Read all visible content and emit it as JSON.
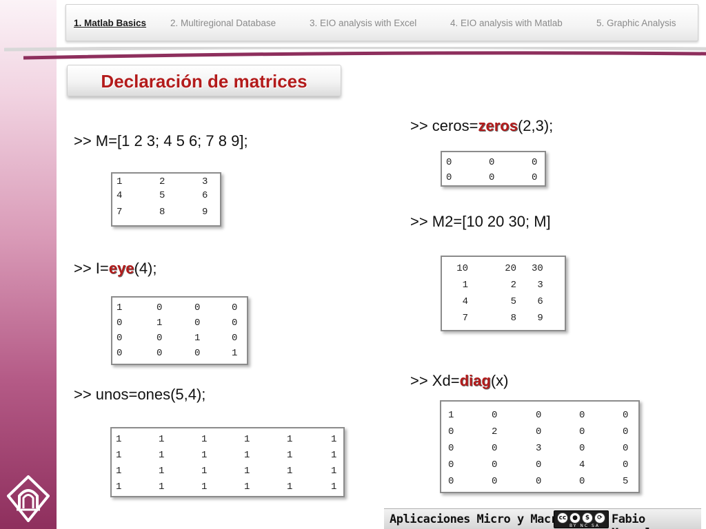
{
  "nav": {
    "items": [
      {
        "label": "1. Matlab Basics",
        "active": true
      },
      {
        "label": "2. Multiregional Database",
        "active": false
      },
      {
        "label": "3. EIO analysis with Excel",
        "active": false
      },
      {
        "label": "4. EIO analysis with Matlab",
        "active": false
      },
      {
        "label": "5. Graphic Analysis",
        "active": false
      }
    ]
  },
  "title": "Declaración de matrices",
  "commands": {
    "m": {
      "prefix": ">> M=[1 2 3; 4 5 6; 7 8 9];"
    },
    "eye": {
      "prefix": ">> I=",
      "keyword": "eye",
      "suffix": "(4);"
    },
    "ones": {
      "prefix": ">> unos=ones(5,4);"
    },
    "zeros": {
      "prefix": ">> ceros=",
      "keyword": "zeros",
      "suffix": "(2,3);"
    },
    "m2": {
      "prefix": ">> M2=[10 20 30; M]"
    },
    "diag": {
      "prefix": ">> Xd=",
      "keyword": "diag",
      "suffix": "(x)"
    }
  },
  "matrices": {
    "m": [
      [
        "1",
        "2",
        "3"
      ],
      [
        "4",
        "5",
        "6"
      ],
      [
        "7",
        "8",
        "9"
      ]
    ],
    "eye": [
      [
        "1",
        "0",
        "0",
        "0"
      ],
      [
        "0",
        "1",
        "0",
        "0"
      ],
      [
        "0",
        "0",
        "1",
        "0"
      ],
      [
        "0",
        "0",
        "0",
        "1"
      ]
    ],
    "ones": [
      [
        "1",
        "1",
        "1",
        "1",
        "1",
        "1"
      ],
      [
        "1",
        "1",
        "1",
        "1",
        "1",
        "1"
      ],
      [
        "1",
        "1",
        "1",
        "1",
        "1",
        "1"
      ],
      [
        "1",
        "1",
        "1",
        "1",
        "1",
        "1"
      ]
    ],
    "zeros": [
      [
        "0",
        "0",
        "0"
      ],
      [
        "0",
        "0",
        "0"
      ]
    ],
    "m2": [
      [
        "10",
        "20",
        "30"
      ],
      [
        "1",
        "2",
        "3"
      ],
      [
        "4",
        "5",
        "6"
      ],
      [
        "7",
        "8",
        "9"
      ]
    ],
    "diag": [
      [
        "1",
        "0",
        "0",
        "0",
        "0"
      ],
      [
        "0",
        "2",
        "0",
        "0",
        "0"
      ],
      [
        "0",
        "0",
        "3",
        "0",
        "0"
      ],
      [
        "0",
        "0",
        "0",
        "4",
        "0"
      ],
      [
        "0",
        "0",
        "0",
        "0",
        "5"
      ]
    ]
  },
  "footer": {
    "left": "Aplicaciones Micro y Macro",
    "right": "Fabio Monsalve",
    "license_labels": "BY NC SA"
  },
  "colors": {
    "keyword": "#b31b1b",
    "title": "#b31b1b",
    "band_dark": "#8e2f5d"
  }
}
